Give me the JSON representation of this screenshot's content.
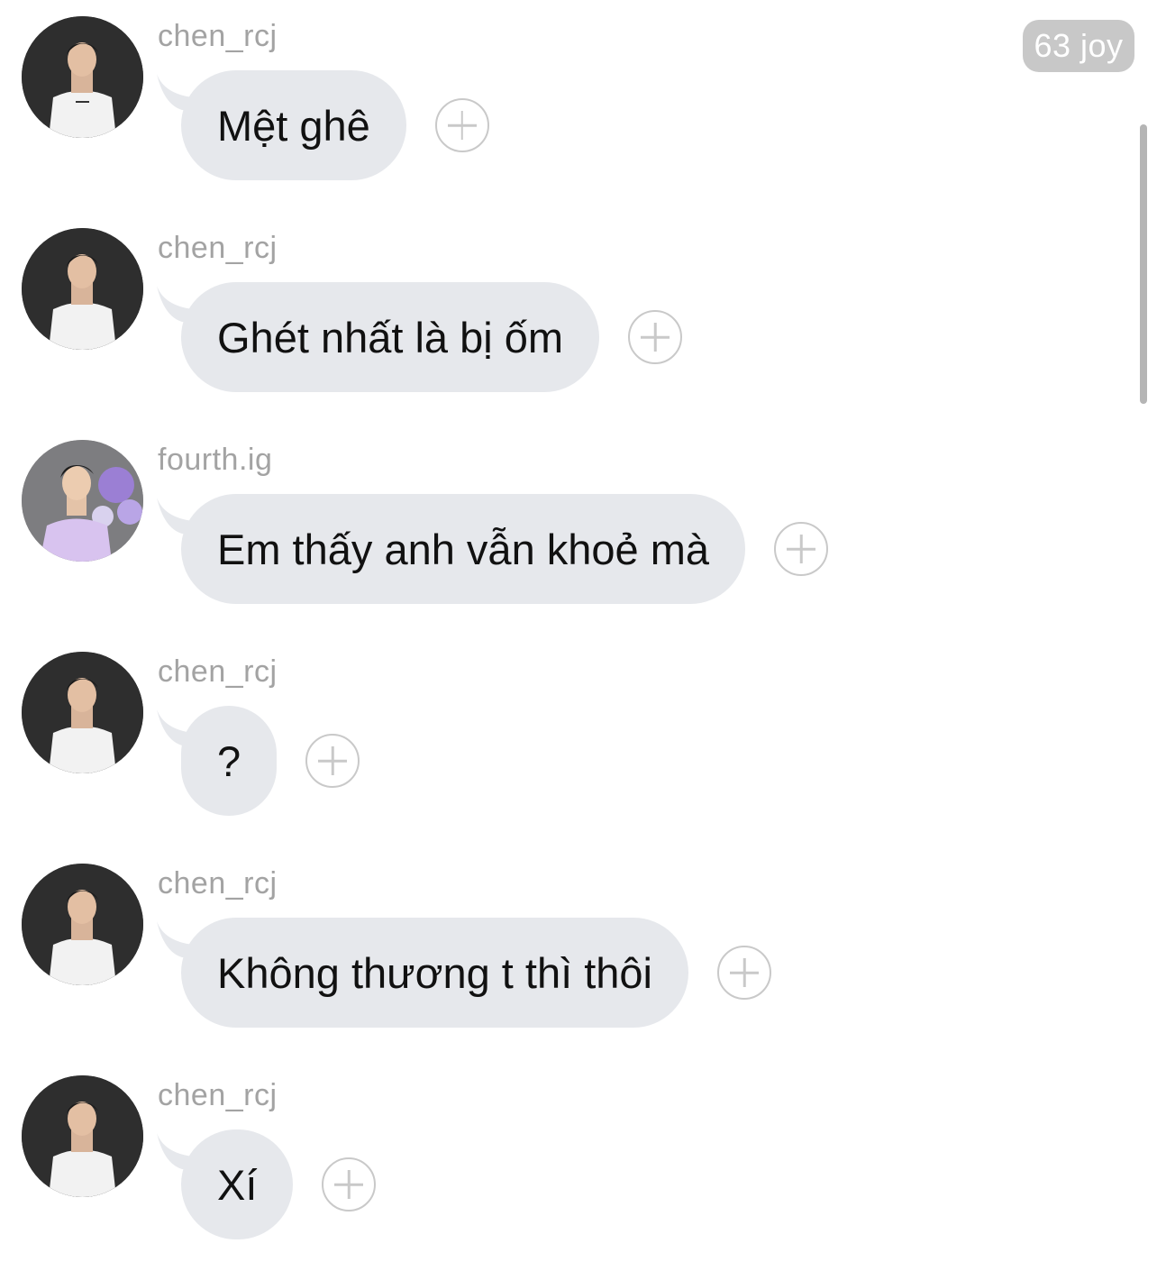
{
  "joy_badge": "63 joy",
  "colors": {
    "bubble_bg": "#e6e8ec",
    "username": "#a3a3a3",
    "badge_bg": "#c8c8c8",
    "plus_icon": "#c9c9c9"
  },
  "messages": [
    {
      "username": "chen_rcj",
      "text": "Mệt ghê",
      "avatar": "dark-photo-avatar"
    },
    {
      "username": "chen_rcj",
      "text": "Ghét nhất là bị ốm",
      "avatar": "dark-photo-avatar"
    },
    {
      "username": "fourth.ig",
      "text": "Em thấy anh vẫn khoẻ mà",
      "avatar": "purple-balloons-avatar"
    },
    {
      "username": "chen_rcj",
      "text": "?",
      "avatar": "dark-photo-avatar"
    },
    {
      "username": "chen_rcj",
      "text": "Không thương t thì thôi",
      "avatar": "dark-photo-avatar"
    },
    {
      "username": "chen_rcj",
      "text": "Xí",
      "avatar": "dark-photo-avatar"
    }
  ]
}
